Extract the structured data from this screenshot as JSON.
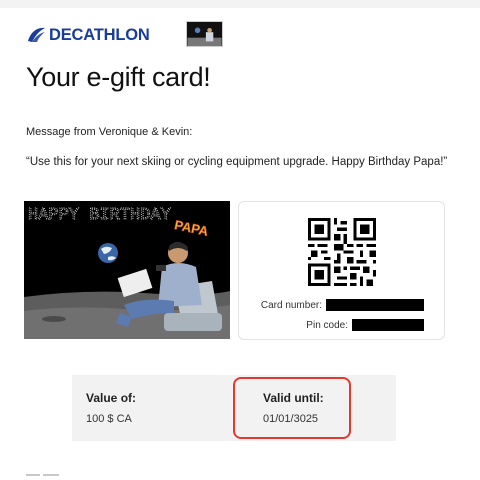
{
  "header": {
    "brand": "DECATHLON",
    "brand_color": "#1a3d9c",
    "logo_icon": "decathlon-logo-icon",
    "thumbnail_icon": "photo-thumbnail"
  },
  "title": "Your e-gift card!",
  "message": {
    "from": "Message from Veronique & Kevin:",
    "body": "“Use this for your next skiing or cycling equipment upgrade. Happy Birthday Papa!”"
  },
  "photo": {
    "banner_text": "HAPPY BIRTHDAY",
    "tag_text": "PAPA"
  },
  "card": {
    "qr_icon": "qr-code",
    "number_label": "Card number:",
    "pin_label": "Pin code:"
  },
  "values": {
    "value_label": "Value of:",
    "value": "100 $ CA",
    "valid_label": "Valid until:",
    "valid_date": "01/01/3025",
    "highlight_color": "#e23a2e"
  }
}
